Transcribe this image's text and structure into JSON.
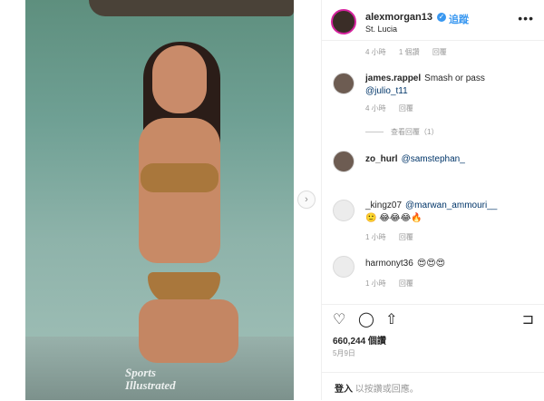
{
  "post": {
    "watermark_line1": "Sports",
    "watermark_line2": "Illustrated"
  },
  "header": {
    "username": "alexmorgan13",
    "verified_glyph": "✓",
    "follow_label": "追蹤",
    "location": "St. Lucia",
    "more_label": "•••"
  },
  "comments": [
    {
      "meta_time": "4 小時",
      "meta_likes": "1 個讚",
      "meta_reply": "回覆"
    },
    {
      "username": "james.rappel",
      "text": "Smash or pass",
      "mention": "@julio_t11",
      "meta_time": "4 小時",
      "meta_reply": "回覆",
      "view_replies": "查看回覆（1）"
    },
    {
      "username": "zo_hurl",
      "mention": "@samstephan_"
    },
    {
      "username": "_kingz07",
      "mention": "@marwan_ammouri__",
      "emojis": "🙂 😂😂😂🔥",
      "meta_time": "1 小時",
      "meta_reply": "回覆"
    },
    {
      "username": "harmonyt36",
      "emojis": "😍😍😍",
      "meta_time": "1 小時",
      "meta_reply": "回覆"
    }
  ],
  "actions": {
    "like_icon": "heart-icon",
    "comment_icon": "comment-icon",
    "share_icon": "share-icon",
    "save_icon": "bookmark-icon"
  },
  "likes_text": "660,244 個讚",
  "date_text": "5月9日",
  "login": {
    "link": "登入",
    "rest": "以按讚或回應。"
  },
  "colors": {
    "accent": "#3897f0",
    "mention": "#003569",
    "muted": "#999999"
  }
}
